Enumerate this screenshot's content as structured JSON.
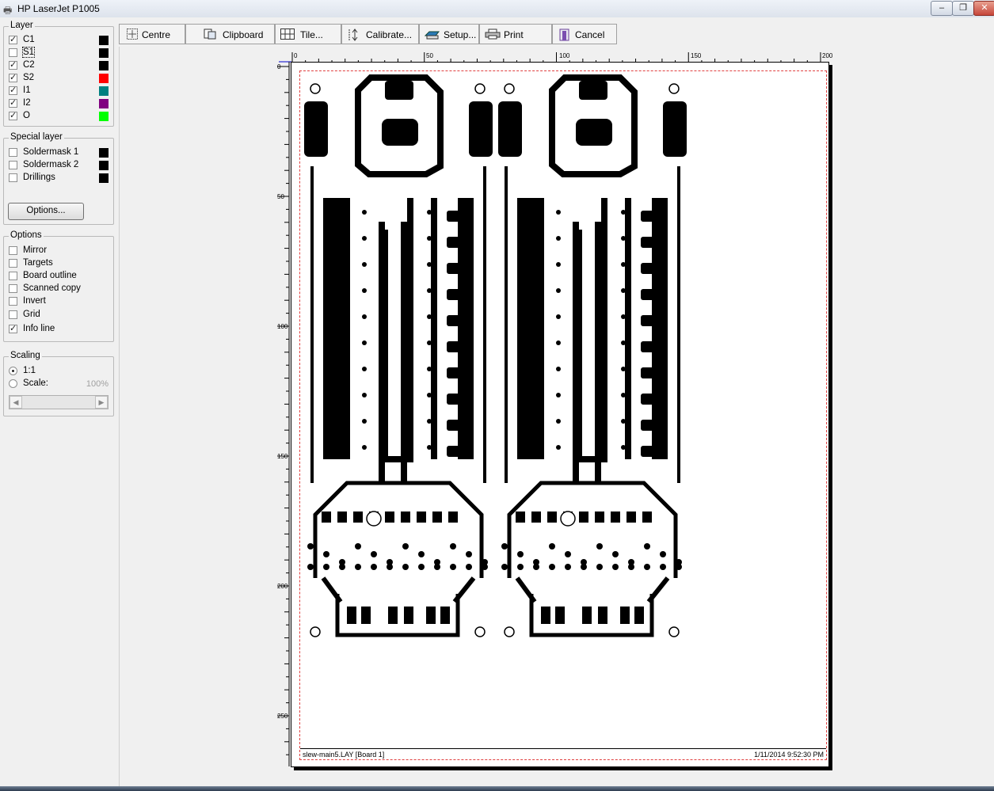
{
  "window": {
    "title": "HP LaserJet P1005",
    "minimize": "–",
    "maximize": "❐",
    "close": "✕"
  },
  "layer_group": {
    "title": "Layer",
    "items": [
      {
        "label": "C1",
        "checked": true,
        "color": "#000000"
      },
      {
        "label": "S1",
        "checked": false,
        "color": "#000000"
      },
      {
        "label": "C2",
        "checked": true,
        "color": "#000000"
      },
      {
        "label": "S2",
        "checked": true,
        "color": "#ff0000"
      },
      {
        "label": "I1",
        "checked": true,
        "color": "#008080"
      },
      {
        "label": "I2",
        "checked": true,
        "color": "#800080"
      },
      {
        "label": "O",
        "checked": true,
        "color": "#00ff00"
      }
    ]
  },
  "special_group": {
    "title": "Special layer",
    "items": [
      {
        "label": "Soldermask 1",
        "checked": false,
        "color": "#000000"
      },
      {
        "label": "Soldermask 2",
        "checked": false,
        "color": "#000000"
      },
      {
        "label": "Drillings",
        "checked": false,
        "color": "#000000"
      }
    ],
    "options_button": "Options..."
  },
  "options_group": {
    "title": "Options",
    "items": [
      {
        "label": "Mirror",
        "checked": false
      },
      {
        "label": "Targets",
        "checked": false
      },
      {
        "label": "Board outline",
        "checked": false
      },
      {
        "label": "Scanned copy",
        "checked": false
      },
      {
        "label": "Invert",
        "checked": false
      },
      {
        "label": "Grid",
        "checked": false
      },
      {
        "label": "Info line",
        "checked": true
      }
    ]
  },
  "scaling_group": {
    "title": "Scaling",
    "option_1to1": "1:1",
    "option_scale": "Scale:",
    "selected": "1:1",
    "scale_value": "100%"
  },
  "toolbar": {
    "buttons": [
      {
        "label": "Centre",
        "icon": "centre-icon"
      },
      {
        "label": "Clipboard",
        "icon": "clipboard-icon"
      },
      {
        "label": "Tile...",
        "icon": "tile-icon"
      },
      {
        "label": "Calibrate...",
        "icon": "calibrate-icon"
      },
      {
        "label": "Setup...",
        "icon": "setup-icon"
      },
      {
        "label": "Print",
        "icon": "printer-icon"
      },
      {
        "label": "Cancel",
        "icon": "cancel-icon"
      }
    ]
  },
  "ruler": {
    "horizontal": [
      "0",
      "50",
      "100",
      "150",
      "200"
    ],
    "vertical": [
      "0",
      "50",
      "100",
      "150",
      "200",
      "250"
    ]
  },
  "info_line": {
    "filename": "slew-main5.LAY  [Board 1]",
    "datetime": "1/11/2014  9:52:30 PM"
  }
}
